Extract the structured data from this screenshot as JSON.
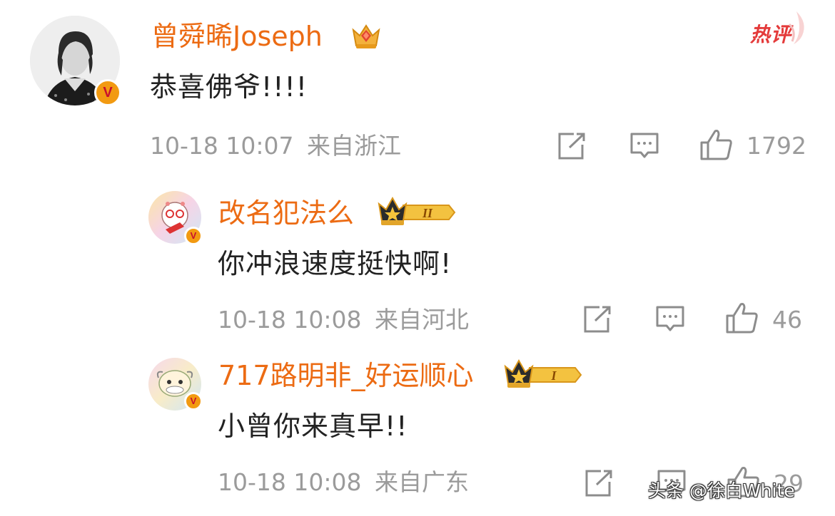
{
  "colors": {
    "username": "#ec6b13",
    "content": "#222222",
    "meta": "#9b9b9b",
    "badge_orange": "#f29a11",
    "hot": "#e43a3a"
  },
  "comments": [
    {
      "username": "曾舜晞Joseph",
      "content": "恭喜佛爷!!!!",
      "time": "10-18 10:07",
      "location": "来自浙江",
      "likes": "1792",
      "badge_icon": "crown-diamond-icon"
    },
    {
      "username": "改名犯法么",
      "content": "你冲浪速度挺快啊!",
      "time": "10-18 10:08",
      "location": "来自河北",
      "likes": "46",
      "badge_icon": "crown-star-icon",
      "level": "II"
    },
    {
      "username": "717路明非_好运顺心",
      "content": "小曾你来真早!!",
      "time": "10-18 10:08",
      "location": "来自广东",
      "likes": "29",
      "badge_icon": "crown-star-icon",
      "level": "I"
    }
  ],
  "hot_badge": "热评",
  "watermark": "头条 @徐白White",
  "icons": [
    "repost-icon",
    "comment-icon",
    "like-icon",
    "verified-v-icon"
  ]
}
